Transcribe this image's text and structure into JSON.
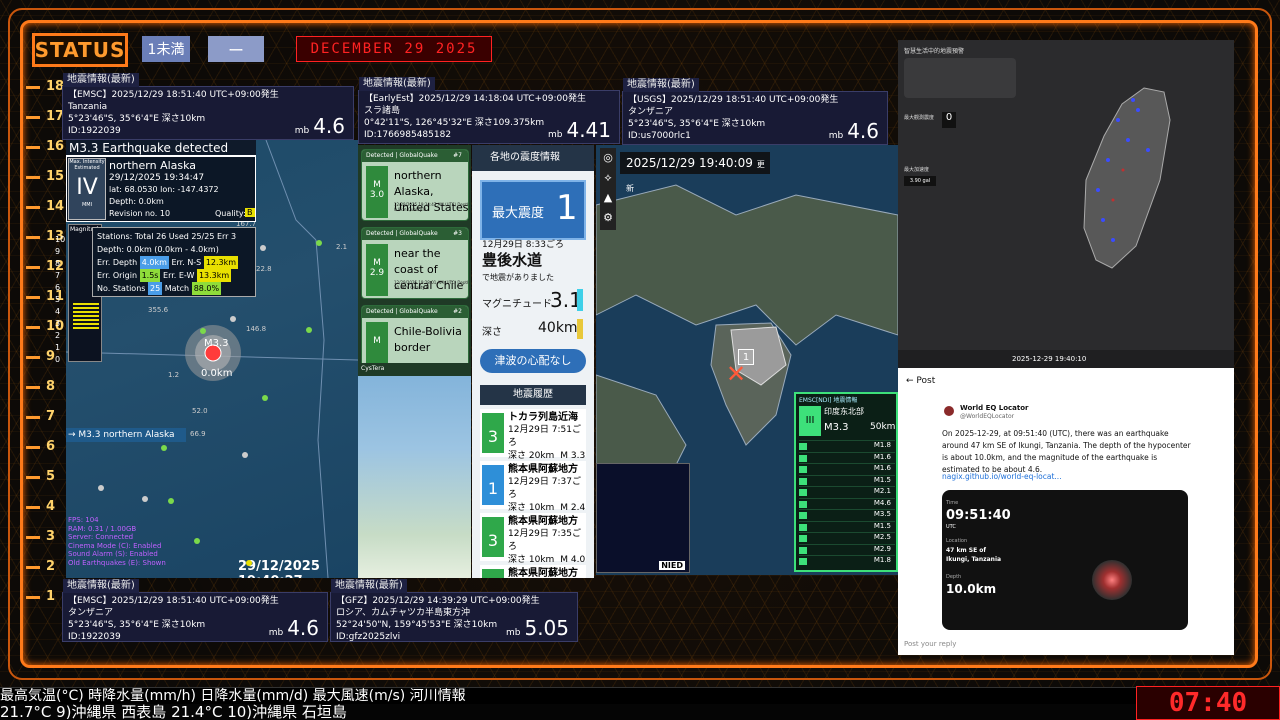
{
  "header": {
    "status_label": "STATUS",
    "tag_level": "1未満",
    "tag_dash": "ー",
    "date": "DECEMBER 29 2025"
  },
  "scale": [
    "18",
    "17",
    "16",
    "15",
    "14",
    "13",
    "12",
    "11",
    "10",
    "9",
    "8",
    "7",
    "6",
    "5",
    "4",
    "3",
    "2",
    "1"
  ],
  "eq_top": [
    {
      "header": "地震情報(最新)",
      "line1": "【EMSC】2025/12/29 18:51:40 UTC+09:00発生",
      "line2": "Tanzania",
      "line3": "5°23'46\"S, 35°6'4\"E 深さ10km",
      "line4": "ID:1922039",
      "mb_label": "mb",
      "mag": "4.6"
    },
    {
      "header": "地震情報(最新)",
      "line1": "【EarlyEst】2025/12/29 14:18:04 UTC+09:00発生",
      "line2": "スラ諸島",
      "line3": "0°42'11\"S, 126°45'32\"E 深さ109.375km",
      "line4": "ID:1766985485182",
      "mb_label": "mb",
      "mag": "4.41"
    },
    {
      "header": "地震情報(最新)",
      "line1": "【USGS】2025/12/29 18:51:40 UTC+09:00発生",
      "line2": "タンザニア",
      "line3": "5°23'46\"S, 35°6'4\"E 深さ10km",
      "line4": "ID:us7000rlc1",
      "mb_label": "mb",
      "mag": "4.6"
    }
  ],
  "eq_bottom": [
    {
      "header": "地震情報(最新)",
      "line1": "【EMSC】2025/12/29 18:51:40 UTC+09:00発生",
      "line2": "タンザニア",
      "line3": "5°23'46\"S, 35°6'4\"E 深さ10km",
      "line4": "ID:1922039",
      "mb_label": "mb",
      "mag": "4.6"
    },
    {
      "header": "地震情報(最新)",
      "line1": "【GFZ】2025/12/29 14:39:29 UTC+09:00発生",
      "line2": "ロシア、カムチャツカ半島東方沖",
      "line3": "52°24'50\"N, 159°45'53\"E 深さ10km",
      "line4": "ID:gfz2025zlvi",
      "mb_label": "mb",
      "mag": "5.05"
    }
  ],
  "alert": {
    "title": "M3.3 Earthquake detected",
    "intensity_label": "Max. Intensity Estimated",
    "intensity": "IV",
    "mmi": "MMI",
    "region": "northern Alaska",
    "time": "29/12/2025 19:34:47",
    "latlon": "lat: 68.0530 lon: -147.4372",
    "depth": "Depth: 0.0km",
    "revision": "Revision no. 10",
    "quality_label": "Quality:",
    "quality": "B"
  },
  "stats": {
    "line1": "Stations: Total 26 Used 25/25 Err 3",
    "line2": "Depth: 0.0km (0.0km - 4.0km)",
    "err_depth_label": "Err. Depth",
    "err_depth": "4.0km",
    "err_ns_label": "Err. N-S",
    "err_ns": "12.3km",
    "err_origin_label": "Err. Origin",
    "err_origin": "1.5s",
    "err_ew_label": "Err. E-W",
    "err_ew": "13.3km",
    "stations_label": "No. Stations",
    "stations": "25",
    "match_label": "Match",
    "match": "88.0%"
  },
  "map1": {
    "magnitude_label": "Magnitude",
    "quake_mag": "M3.3",
    "quake_depth": "0.0km",
    "side_alert": "→ M3.3 northern Alaska",
    "timestamp": "29/12/2025 19:40:27",
    "numbers": [
      "112.0",
      "29.6",
      "247.8",
      "167.7",
      "2.1",
      "22.8",
      "529.3",
      "355.6",
      "146.8",
      "1.2",
      "52.0",
      "66.9"
    ],
    "status": [
      "FPS: 104",
      "RAM: 0.31 / 1.00GB",
      "Server: Connected",
      "Cinema Mode (C): Enabled",
      "Sound Alarm (S): Enabled",
      "Old Earthquakes (E): Shown"
    ]
  },
  "mag_scale": [
    "10",
    "9",
    "8",
    "7",
    "6",
    "5",
    "4",
    "3",
    "2",
    "1",
    "0"
  ],
  "gq": [
    {
      "header": "Detected | GlobalQuake",
      "num": "#7",
      "m_label": "M",
      "mag": "3.0",
      "loc": "northern Alaska, United States",
      "meta": "12/29/2025 19:34:47 AM (UTC) Depth 0.0km Quality B"
    },
    {
      "header": "Detected | GlobalQuake",
      "num": "#3",
      "m_label": "M",
      "mag": "2.9",
      "loc": "near the coast of central Chile",
      "meta": "12/29/2025 19:28:01 AM (UTC) Depth 10.0km Quality B"
    },
    {
      "header": "Detected | GlobalQuake",
      "num": "#2",
      "m_label": "M",
      "mag": "",
      "loc": "Chile-Bolivia border",
      "meta": ""
    }
  ],
  "gq_footer": "CysTera",
  "jma": {
    "title": "各地の震度情報",
    "max_label": "最大震度",
    "max_value": "1",
    "date": "12月29日 8:33ごろ",
    "region": "豊後水道",
    "sub": "で地震がありました",
    "mag_label": "マグニチュード",
    "mag": "3.1",
    "depth_label": "深さ",
    "depth": "40km",
    "tsunami": "津波の心配なし",
    "history_title": "地震履歴",
    "history": [
      {
        "int": "3",
        "region": "トカラ列島近海",
        "time": "12月29日 7:51ごろ",
        "depth": "深さ 20km",
        "mag": "M 3.3"
      },
      {
        "int": "1",
        "region": "熊本県阿蘇地方",
        "time": "12月29日 7:37ごろ",
        "depth": "深さ 10km",
        "mag": "M 2.4"
      },
      {
        "int": "3",
        "region": "熊本県阿蘇地方",
        "time": "12月29日 7:35ごろ",
        "depth": "深さ 10km",
        "mag": "M 4.0"
      },
      {
        "int": "",
        "region": "熊本県阿蘇地方",
        "time": "",
        "depth": "",
        "mag": ""
      }
    ]
  },
  "jpmap": {
    "time": "2025/12/29 19:40:09",
    "update": "更新",
    "marker": "1",
    "emsc_title": "EMSC[NDI] 地震情報",
    "emsc_region": "印度东北部",
    "emsc_mag": "M3.3",
    "emsc_depth": "50km",
    "emsc_int": "III",
    "list": [
      "M1.8",
      "M1.6",
      "M1.6",
      "M1.5",
      "M2.1",
      "M4.6",
      "M3.5",
      "M1.5",
      "M2.5",
      "M2.9",
      "M1.8"
    ],
    "nied": "NIED"
  },
  "tw": {
    "title": "智慧生活中的地震預警",
    "label1": "最大觀測震度",
    "value1": "0",
    "label2": "最大加速度",
    "value2": "3.90 gal",
    "time": "2025-12-29 19:40:10"
  },
  "post": {
    "back": "Post",
    "name": "World EQ Locator",
    "handle": "@WorldEQLocator",
    "text": "On 2025-12-29, at 09:51:40 (UTC), there was an earthquake around 47 km SE of Ikungi, Tanzania. The depth of the hypocenter is about 10.0km, and the magnitude of the earthquake is estimated to be about 4.6.",
    "link": "nagix.github.io/world-eq-locat...",
    "img_time_label": "Time",
    "img_time": "09:51:40",
    "img_utc": "UTC",
    "img_loc_label": "Location",
    "img_loc": "47 km SE of Ikungi, Tanzania",
    "img_depth_label": "Depth",
    "img_depth": "10.0km",
    "reply": "Post your reply"
  },
  "ticker1": "最高気温(°C) 時降水量(mm/h) 日降水量(mm/d) 最大風速(m/s) 河川情報",
  "ticker2": "21.7°C 9)沖縄県 西表島 21.4°C 10)沖縄県 石垣島",
  "clock": "07:40",
  "colors": {
    "accent": "#ff7a1a",
    "alert": "#ff2222",
    "jma_blue": "#2e6fb8",
    "gq_green": "#2f8a3c"
  }
}
